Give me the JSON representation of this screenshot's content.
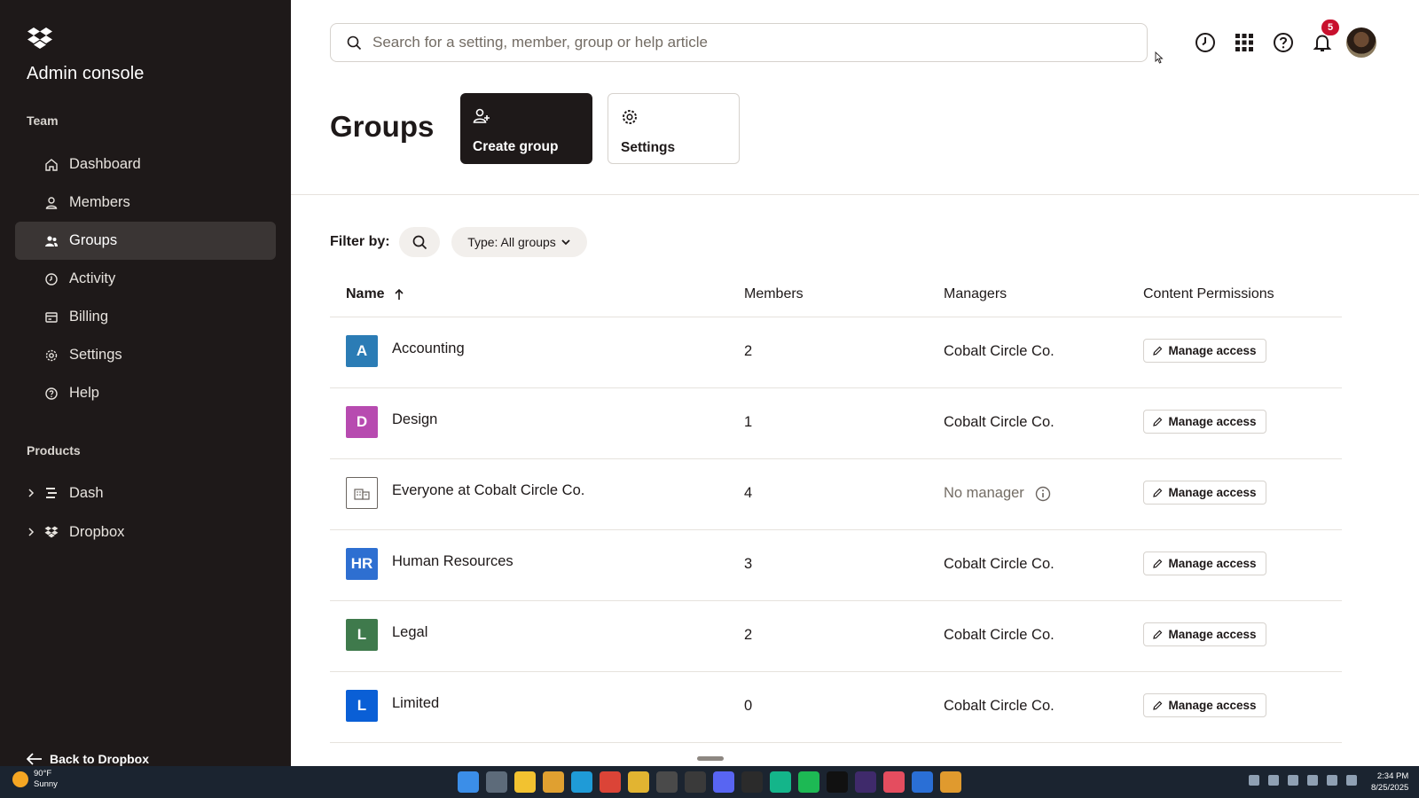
{
  "sidebar": {
    "title": "Admin console",
    "team_label": "Team",
    "items": [
      {
        "label": "Dashboard",
        "icon": "home-icon"
      },
      {
        "label": "Members",
        "icon": "person-icon"
      },
      {
        "label": "Groups",
        "icon": "people-icon",
        "active": true
      },
      {
        "label": "Activity",
        "icon": "clock-icon"
      },
      {
        "label": "Billing",
        "icon": "card-icon"
      },
      {
        "label": "Settings",
        "icon": "gear-icon"
      },
      {
        "label": "Help",
        "icon": "help-icon"
      }
    ],
    "products_label": "Products",
    "products": [
      {
        "label": "Dash",
        "icon": "dash-icon"
      },
      {
        "label": "Dropbox",
        "icon": "dropbox-icon"
      }
    ],
    "back_label": "Back to Dropbox"
  },
  "topbar": {
    "search_placeholder": "Search for a setting, member, group or help article",
    "notification_count": "5"
  },
  "header": {
    "title": "Groups",
    "create_label": "Create group",
    "settings_label": "Settings"
  },
  "filter": {
    "label": "Filter by:",
    "type_label": "Type: All groups"
  },
  "table": {
    "headers": {
      "name": "Name",
      "members": "Members",
      "managers": "Managers",
      "permissions": "Content Permissions"
    },
    "rows": [
      {
        "initial": "A",
        "color": "#2b7cb5",
        "name": "Accounting",
        "members": "2",
        "manager": "Cobalt Circle Co.",
        "action": "Manage access"
      },
      {
        "initial": "D",
        "color": "#b74bb0",
        "name": "Design",
        "members": "1",
        "manager": "Cobalt Circle Co.",
        "action": "Manage access"
      },
      {
        "initial": "",
        "color": "#ffffff",
        "name": "Everyone at Cobalt Circle Co.",
        "members": "4",
        "manager": "No manager",
        "action": "Manage access"
      },
      {
        "initial": "HR",
        "color": "#2e6fd1",
        "name": "Human Resources",
        "members": "3",
        "manager": "Cobalt Circle Co.",
        "action": "Manage access"
      },
      {
        "initial": "L",
        "color": "#3f7a4c",
        "name": "Legal",
        "members": "2",
        "manager": "Cobalt Circle Co.",
        "action": "Manage access"
      },
      {
        "initial": "L",
        "color": "#0a5fd6",
        "name": "Limited",
        "members": "0",
        "manager": "Cobalt Circle Co.",
        "action": "Manage access"
      }
    ]
  },
  "taskbar": {
    "temperature": "90°F",
    "condition": "Sunny",
    "time": "2:34 PM",
    "date": "8/25/2025"
  }
}
